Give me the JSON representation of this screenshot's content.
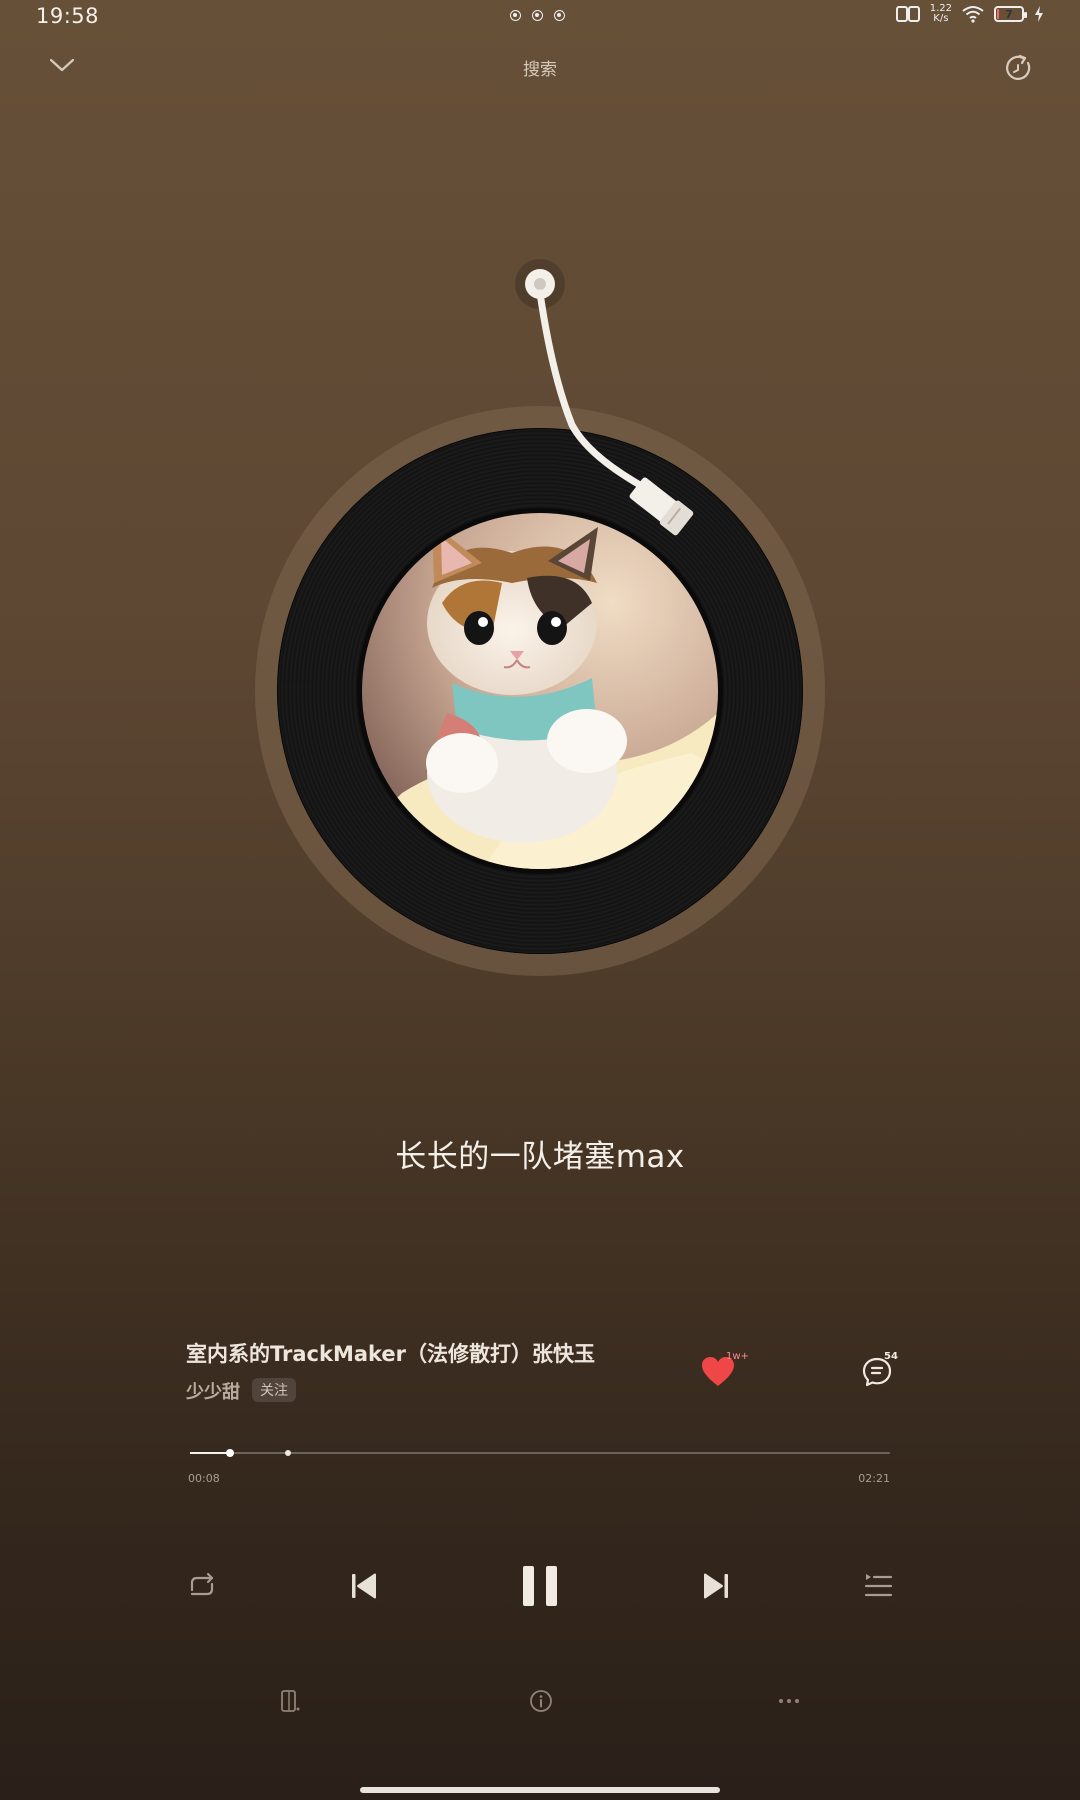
{
  "status_bar": {
    "time": "19:58",
    "net_speed_value": "1.22",
    "net_speed_unit": "K/s",
    "battery_level": 7,
    "battery_text": "7"
  },
  "top_bar": {
    "search_label": "搜索"
  },
  "lyric": {
    "current_line": "长长的一队堵塞max"
  },
  "song": {
    "title": "室内系的TrackMaker（法修散打）张快玉",
    "artist": "少少甜",
    "follow_label": "关注",
    "like_count": "1w+",
    "comment_count": "54",
    "liked": true
  },
  "playback": {
    "current_time": "00:08",
    "total_time": "02:21",
    "progress_fraction": 0.057,
    "buffered_fraction": 0.14,
    "state": "playing"
  },
  "icons": {
    "collapse": "chevron-down-icon",
    "share": "refresh-share-icon",
    "like": "heart-icon",
    "comment": "comment-icon",
    "repeat": "repeat-icon",
    "previous": "previous-icon",
    "pause": "pause-icon",
    "next": "next-icon",
    "playlist": "playlist-icon",
    "device": "device-switch-icon",
    "info": "info-icon",
    "more": "more-icon"
  },
  "colors": {
    "like_red": "#ef4747",
    "bg_top": "#675038",
    "bg_bottom": "#2a2019"
  }
}
